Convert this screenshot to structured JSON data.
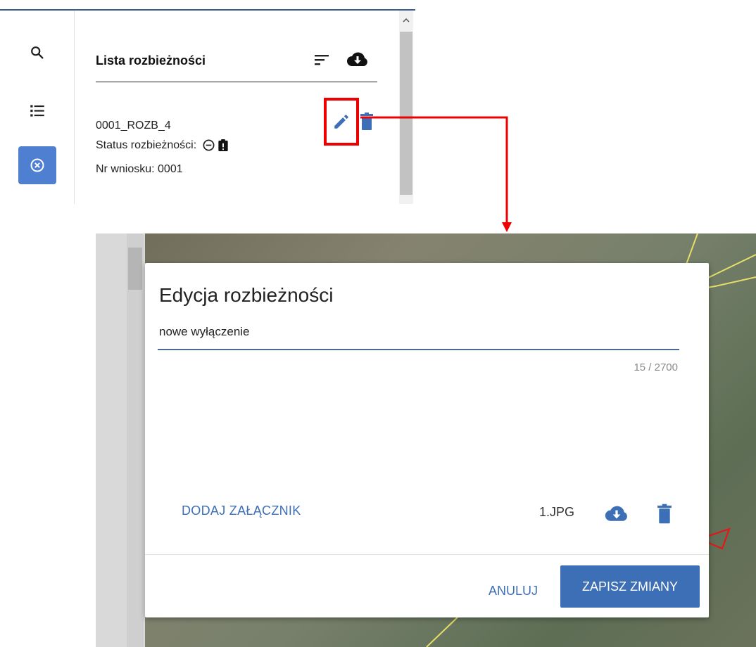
{
  "sidebar_panel": {
    "title": "Lista rozbieżności",
    "item": {
      "id": "0001_ROZB_4",
      "status_label": "Status rozbieżności:",
      "request_label": "Nr wniosku: 0001"
    }
  },
  "dialog": {
    "title": "Edycja rozbieżności",
    "input_value": "nowe wyłączenie",
    "char_counter": "15 / 2700",
    "add_attachment": "DODAJ ZAŁĄCZNIK",
    "attachment_name": "1.JPG",
    "cancel_label": "ANULUJ",
    "save_label": "ZAPISZ ZMIANY"
  },
  "colors": {
    "accent": "#3d6fb6",
    "highlight": "#ee0000",
    "active_rail": "#4f7fd0"
  },
  "icons": [
    "search-icon",
    "list-icon",
    "close-circle-icon",
    "sort-icon",
    "cloud-download-icon",
    "edit-icon",
    "delete-icon",
    "minus-circle-icon",
    "clipboard-alert-icon"
  ]
}
